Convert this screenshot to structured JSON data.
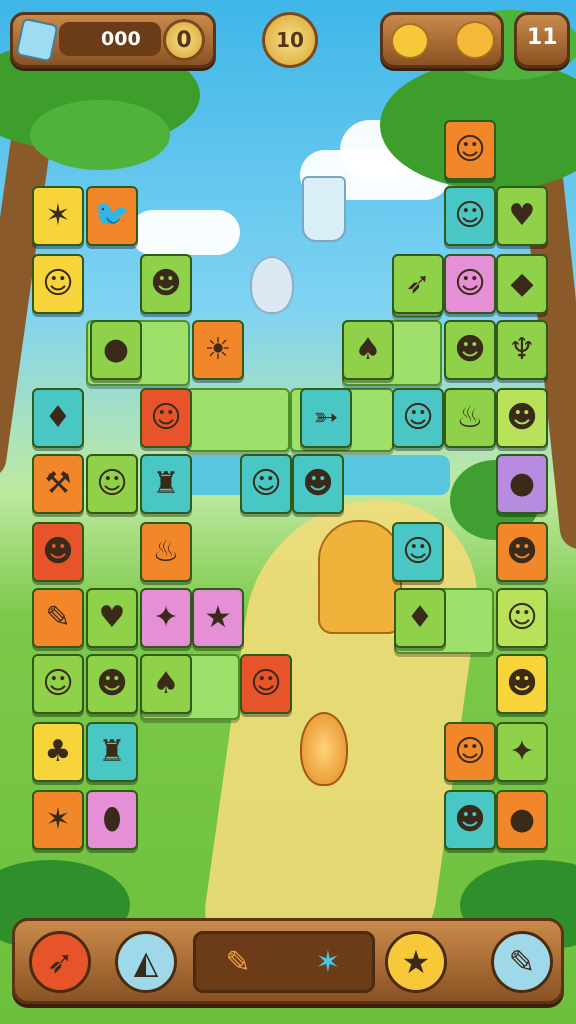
{
  "hud": {
    "score_value": "000",
    "score_counter": "0",
    "level_value": "10",
    "moves_value": "11",
    "colors": {
      "panel": "#a8672f",
      "coin": "#e6bd4d"
    }
  },
  "board": {
    "tiles": [
      {
        "name": "tile-blue-star",
        "icon": "star-creature-icon",
        "glyph": "✶",
        "color": "yellow"
      },
      {
        "name": "tile-blue-cap-bird",
        "icon": "bird-icon",
        "glyph": "🐦",
        "color": "orange"
      },
      {
        "name": "tile-red-hat-face",
        "icon": "face-icon",
        "glyph": "☺",
        "color": "yellow"
      },
      {
        "name": "tile-boy-face",
        "icon": "face-icon",
        "glyph": "☻",
        "color": "green"
      },
      {
        "name": "tile-red-apple",
        "icon": "apple-icon",
        "glyph": "●",
        "color": "green"
      },
      {
        "name": "tile-sun",
        "icon": "sun-icon",
        "glyph": "☀",
        "color": "orange"
      },
      {
        "name": "tile-duck",
        "icon": "duck-icon",
        "glyph": "♦",
        "color": "teal"
      },
      {
        "name": "tile-fireman",
        "icon": "fireman-icon",
        "glyph": "☺",
        "color": "red"
      },
      {
        "name": "tile-hammer",
        "icon": "hammer-icon",
        "glyph": "⚒",
        "color": "orange"
      },
      {
        "name": "tile-cat",
        "icon": "cat-icon",
        "glyph": "☺",
        "color": "green"
      },
      {
        "name": "tile-robot",
        "icon": "robot-icon",
        "glyph": "♜",
        "color": "teal"
      },
      {
        "name": "tile-boy-red-cap",
        "icon": "face-icon",
        "glyph": "☻",
        "color": "red"
      },
      {
        "name": "tile-bottle",
        "icon": "bottle-icon",
        "glyph": "♨",
        "color": "orange"
      },
      {
        "name": "tile-pencil",
        "icon": "pencil-icon",
        "glyph": "✎",
        "color": "orange"
      },
      {
        "name": "tile-potion",
        "icon": "potion-icon",
        "glyph": "♥",
        "color": "green"
      },
      {
        "name": "tile-fish",
        "icon": "fish-icon",
        "glyph": "✦",
        "color": "pink"
      },
      {
        "name": "tile-star-face",
        "icon": "star-face-icon",
        "glyph": "★",
        "color": "pink"
      },
      {
        "name": "tile-monkey",
        "icon": "monkey-icon",
        "glyph": "☺",
        "color": "green"
      },
      {
        "name": "tile-cowboy",
        "icon": "cowboy-icon",
        "glyph": "☻",
        "color": "green"
      },
      {
        "name": "tile-cowboy-duck",
        "icon": "duck-icon",
        "glyph": "♠",
        "color": "green"
      },
      {
        "name": "tile-fire-helmet",
        "icon": "helmet-icon",
        "glyph": "☺",
        "color": "red"
      },
      {
        "name": "tile-yellow-fox",
        "icon": "fox-icon",
        "glyph": "♣",
        "color": "yellow"
      },
      {
        "name": "tile-mask-robot",
        "icon": "robot-icon",
        "glyph": "♜",
        "color": "teal"
      },
      {
        "name": "tile-star-blue",
        "icon": "star-creature-icon",
        "glyph": "✶",
        "color": "orange"
      },
      {
        "name": "tile-egg-face",
        "icon": "egg-icon",
        "glyph": "⬮",
        "color": "pink"
      },
      {
        "name": "tile-fireman-right",
        "icon": "fireman-icon",
        "glyph": "☺",
        "color": "orange"
      },
      {
        "name": "tile-purple-girl",
        "icon": "girl-icon",
        "glyph": "☺",
        "color": "teal"
      },
      {
        "name": "tile-radish",
        "icon": "radish-icon",
        "glyph": "♥",
        "color": "green"
      },
      {
        "name": "tile-carrot",
        "icon": "carrot-icon",
        "glyph": "➶",
        "color": "green"
      },
      {
        "name": "tile-pink-girl",
        "icon": "girl-icon",
        "glyph": "☺",
        "color": "pink"
      },
      {
        "name": "tile-purple-gem",
        "icon": "gem-icon",
        "glyph": "◆",
        "color": "green"
      },
      {
        "name": "tile-duck-hat",
        "icon": "duck-icon",
        "glyph": "♠",
        "color": "green"
      },
      {
        "name": "tile-helmet-dark",
        "icon": "helmet-icon",
        "glyph": "☻",
        "color": "green"
      },
      {
        "name": "tile-ice-cream",
        "icon": "ice-cream-icon",
        "glyph": "♆",
        "color": "green"
      },
      {
        "name": "tile-bird-flying",
        "icon": "bird-icon",
        "glyph": "➳",
        "color": "teal"
      },
      {
        "name": "tile-balloon-girl",
        "icon": "girl-icon",
        "glyph": "☺",
        "color": "teal"
      },
      {
        "name": "tile-torch",
        "icon": "torch-icon",
        "glyph": "♨",
        "color": "green"
      },
      {
        "name": "tile-blue-cap-kid",
        "icon": "face-icon",
        "glyph": "☻",
        "color": "lime"
      },
      {
        "name": "tile-red-cap-kid",
        "icon": "face-icon",
        "glyph": "☺",
        "color": "teal"
      },
      {
        "name": "tile-yellow-hat-kid",
        "icon": "face-icon",
        "glyph": "☻",
        "color": "teal"
      },
      {
        "name": "tile-plum",
        "icon": "plum-icon",
        "glyph": "●",
        "color": "purple"
      },
      {
        "name": "tile-blue-hat-kid",
        "icon": "face-icon",
        "glyph": "☺",
        "color": "teal"
      },
      {
        "name": "tile-girl-brown",
        "icon": "girl-icon",
        "glyph": "☻",
        "color": "orange"
      },
      {
        "name": "tile-carrot-small",
        "icon": "carrot-icon",
        "glyph": "♦",
        "color": "green"
      },
      {
        "name": "tile-red-cap-girl",
        "icon": "girl-icon",
        "glyph": "☺",
        "color": "lime"
      },
      {
        "name": "tile-blonde-girl",
        "icon": "girl-icon",
        "glyph": "☻",
        "color": "yellow"
      },
      {
        "name": "tile-balloon-kid",
        "icon": "face-icon",
        "glyph": "☺",
        "color": "orange"
      },
      {
        "name": "tile-candy",
        "icon": "candy-icon",
        "glyph": "✦",
        "color": "green"
      },
      {
        "name": "tile-police-kid",
        "icon": "face-icon",
        "glyph": "☻",
        "color": "teal"
      },
      {
        "name": "tile-orange-bird",
        "icon": "bird-icon",
        "glyph": "●",
        "color": "orange"
      }
    ]
  },
  "toolbar": {
    "tools": [
      {
        "name": "rocket-button",
        "icon": "rocket-icon",
        "glyph": "➶",
        "color": "#e8542a"
      },
      {
        "name": "shuffle-button",
        "icon": "cheese-icon",
        "glyph": "◭",
        "color": "#9fd8e8"
      },
      {
        "name": "star-button",
        "icon": "star-icon",
        "glyph": "★",
        "color": "#f7c93a"
      },
      {
        "name": "pencil-button",
        "icon": "pencil-icon",
        "glyph": "✎",
        "color": "#9fd8e8"
      }
    ],
    "tray": [
      {
        "name": "tray-pencil",
        "icon": "pencil-icon",
        "glyph": "✎"
      },
      {
        "name": "tray-blue-star",
        "icon": "star-creature-icon",
        "glyph": "✶"
      }
    ]
  }
}
